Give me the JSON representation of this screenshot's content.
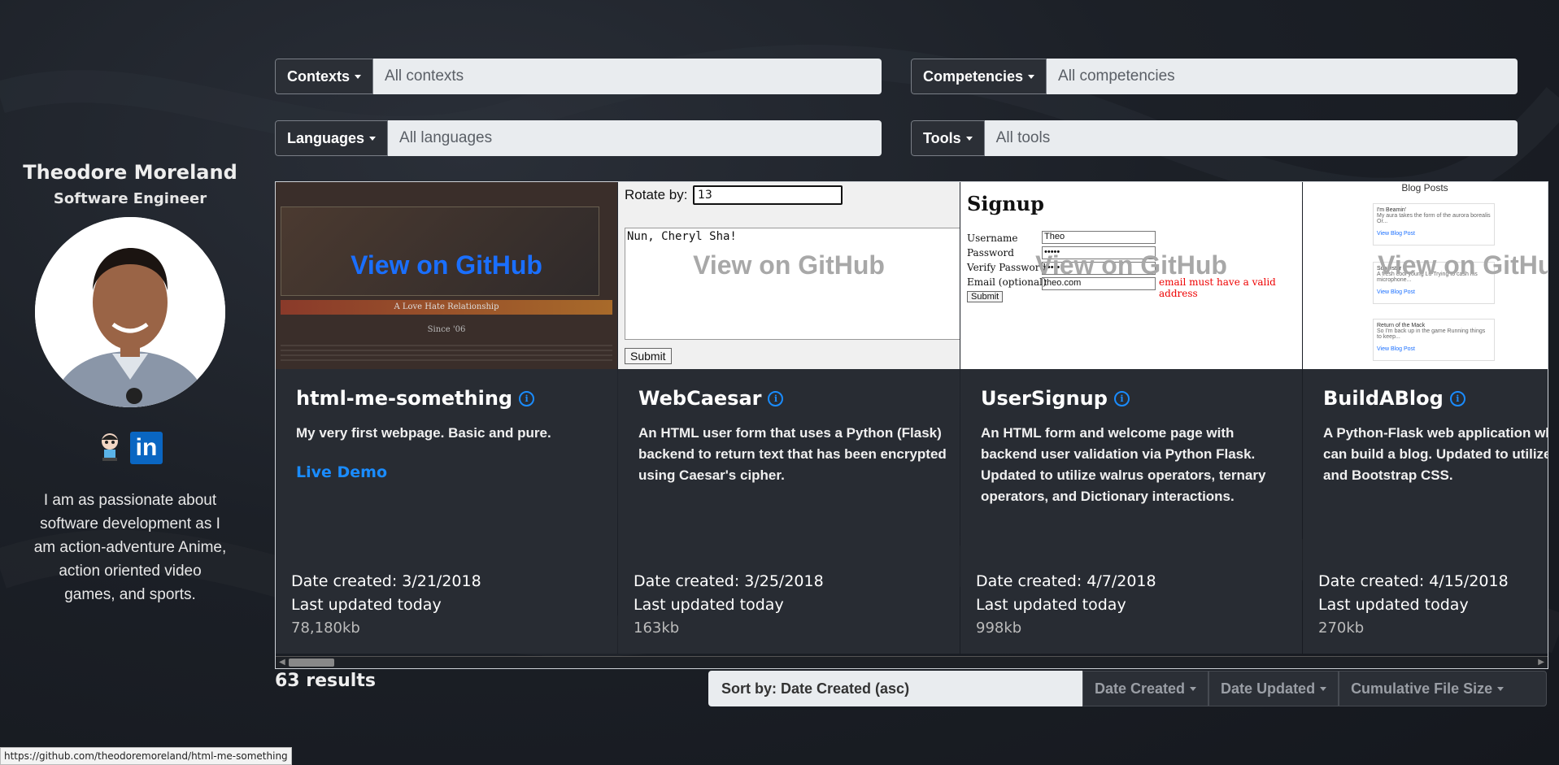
{
  "profile": {
    "name": "Theodore Moreland",
    "role": "Software Engineer",
    "bio": "I am as passionate about software development as I am action-adventure Anime, action oriented video games, and sports."
  },
  "filters": [
    {
      "label": "Contexts",
      "value": "All contexts"
    },
    {
      "label": "Competencies",
      "value": "All competencies"
    },
    {
      "label": "Languages",
      "value": "All languages"
    },
    {
      "label": "Tools",
      "value": "All tools"
    }
  ],
  "overlay_text": "View on GitHub",
  "cards": [
    {
      "title": "html-me-something",
      "description": "My very first webpage. Basic and pure.",
      "demo_link": "Live Demo",
      "created": "Date created: 3/21/2018",
      "updated": "Last updated today",
      "size": "78,180kb",
      "thumb": {
        "caption1": "A Love Hate Relationship",
        "caption2": "Since '06"
      }
    },
    {
      "title": "WebCaesar",
      "description": "An HTML user form that uses a Python (Flask) backend to return text that has been encrypted using Caesar's cipher.",
      "created": "Date created: 3/25/2018",
      "updated": "Last updated today",
      "size": "163kb",
      "thumb": {
        "rotate_label": "Rotate by:",
        "rotate_value": "13",
        "text": "Nun, Cheryl Sha!",
        "submit": "Submit"
      }
    },
    {
      "title": "UserSignup",
      "description": "An HTML form and welcome page with backend user validation via Python Flask. Updated to utilize walrus operators, ternary operators, and Dictionary interactions.",
      "created": "Date created: 4/7/2018",
      "updated": "Last updated today",
      "size": "998kb",
      "thumb": {
        "heading": "Signup",
        "username_label": "Username",
        "username_value": "Theo",
        "password_label": "Password",
        "password_value": "•••••",
        "verify_label": "Verify Password",
        "verify_value": "•••••",
        "email_label": "Email (optional)",
        "email_value": "theo.com",
        "email_error": "email must have a valid address",
        "submit": "Submit"
      }
    },
    {
      "title": "BuildABlog",
      "description": "A Python-Flask web application where a user can build a blog. Updated to utilize blueprints and Bootstrap CSS.",
      "created": "Date created: 4/15/2018",
      "updated": "Last updated today",
      "size": "270kb",
      "thumb": {
        "heading": "Blog Posts",
        "posts": [
          {
            "title": "I'm Beamin'",
            "body": "My aura takes the form of the aurora borealis Or...",
            "link": "View Blog Post"
          },
          {
            "title": "Superstar",
            "body": "A fresh cool young Lu Trying to cash his microphone...",
            "link": "View Blog Post"
          },
          {
            "title": "Return of the Mack",
            "body": "So I'm back up in the game Running things to keep...",
            "link": "View Blog Post"
          }
        ]
      }
    }
  ],
  "results": "63 results",
  "sort": {
    "label": "Sort by: Date Created (asc)",
    "buttons": [
      "Date Created",
      "Date Updated",
      "Cumulative File Size"
    ]
  },
  "status_url": "https://github.com/theodoremoreland/html-me-something",
  "colors": {
    "accent": "#1a8cff",
    "card_bg": "#282c33",
    "field_bg": "#e9ecef"
  }
}
